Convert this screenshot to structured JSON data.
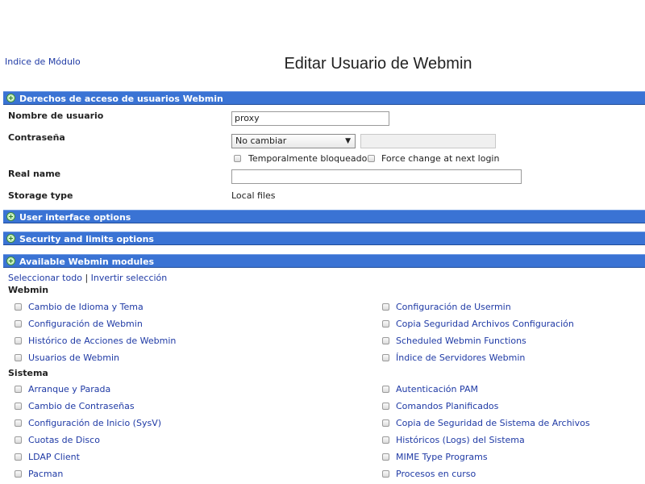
{
  "header": {
    "module_index": "Indice de Módulo",
    "title": "Editar Usuario de Webmin"
  },
  "sections": {
    "access": "Derechos de acceso de usuarios Webmin",
    "ui_options": "User interface options",
    "security": "Security and limits options",
    "modules": "Available Webmin modules"
  },
  "form": {
    "username_label": "Nombre de usuario",
    "username_value": "proxy",
    "password_label": "Contraseña",
    "password_select": "No cambiar",
    "temp_locked": "Temporalmente bloqueado",
    "force_change": "Force change at next login",
    "realname_label": "Real name",
    "realname_value": "",
    "storage_label": "Storage type",
    "storage_value": "Local files"
  },
  "modules": {
    "select_all": "Seleccionar todo",
    "separator": "|",
    "invert": "Invertir selección",
    "groups": [
      {
        "name": "Webmin",
        "left": [
          "Cambio de Idioma y Tema",
          "Configuración de Webmin",
          "Histórico de Acciones de Webmin",
          "Usuarios de Webmin"
        ],
        "right": [
          "Configuración de Usermin",
          "Copia Seguridad Archivos Configuración",
          "Scheduled Webmin Functions",
          "Índice de Servidores Webmin"
        ]
      },
      {
        "name": "Sistema",
        "left": [
          "Arranque y Parada",
          "Cambio de Contraseñas",
          "Configuración de Inicio (SysV)",
          "Cuotas de Disco",
          "LDAP Client",
          "Pacman"
        ],
        "right": [
          "Autenticación PAM",
          "Comandos Planificados",
          "Copia de Seguridad de Sistema de Archivos",
          "Históricos (Logs) del Sistema",
          "MIME Type Programs",
          "Procesos en curso"
        ]
      }
    ]
  },
  "colors": {
    "section_bar": "#3a73d4",
    "link": "#1f3aa5"
  }
}
